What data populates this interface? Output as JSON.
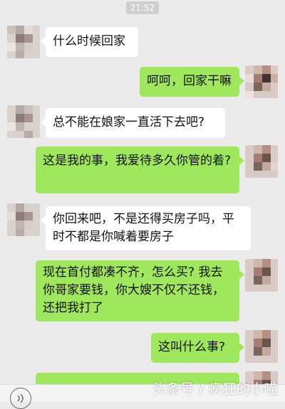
{
  "status_time": "21:52",
  "messages": [
    {
      "side": "left",
      "text": "什么时候回家"
    },
    {
      "side": "right",
      "text": "呵呵，回家干嘛"
    },
    {
      "side": "left",
      "text": "总不能在娘家一直活下去吧?"
    },
    {
      "side": "right",
      "text": "这是我的事，我爱待多久你管的着?"
    },
    {
      "side": "left",
      "text": "你回来吧，不是还得买房子吗，平时不都是你喊着要房子"
    },
    {
      "side": "right",
      "text": "现在首付都凑不齐，怎么买? 我去你哥家要钱，你大嫂不仅不还钱，还把我打了"
    },
    {
      "side": "right",
      "text": "这叫什么事?"
    },
    {
      "side": "right",
      "text": ""
    }
  ],
  "watermark": "头条号 / 疯狂的小喵",
  "icons": {
    "voice": "voice-icon",
    "avatar_left": "avatar-icon",
    "avatar_right": "avatar-icon"
  },
  "colors": {
    "background": "#ebebeb",
    "left_bubble": "#ffffff",
    "right_bubble": "#9fe75c",
    "time_pill": "#cfcfcf"
  }
}
